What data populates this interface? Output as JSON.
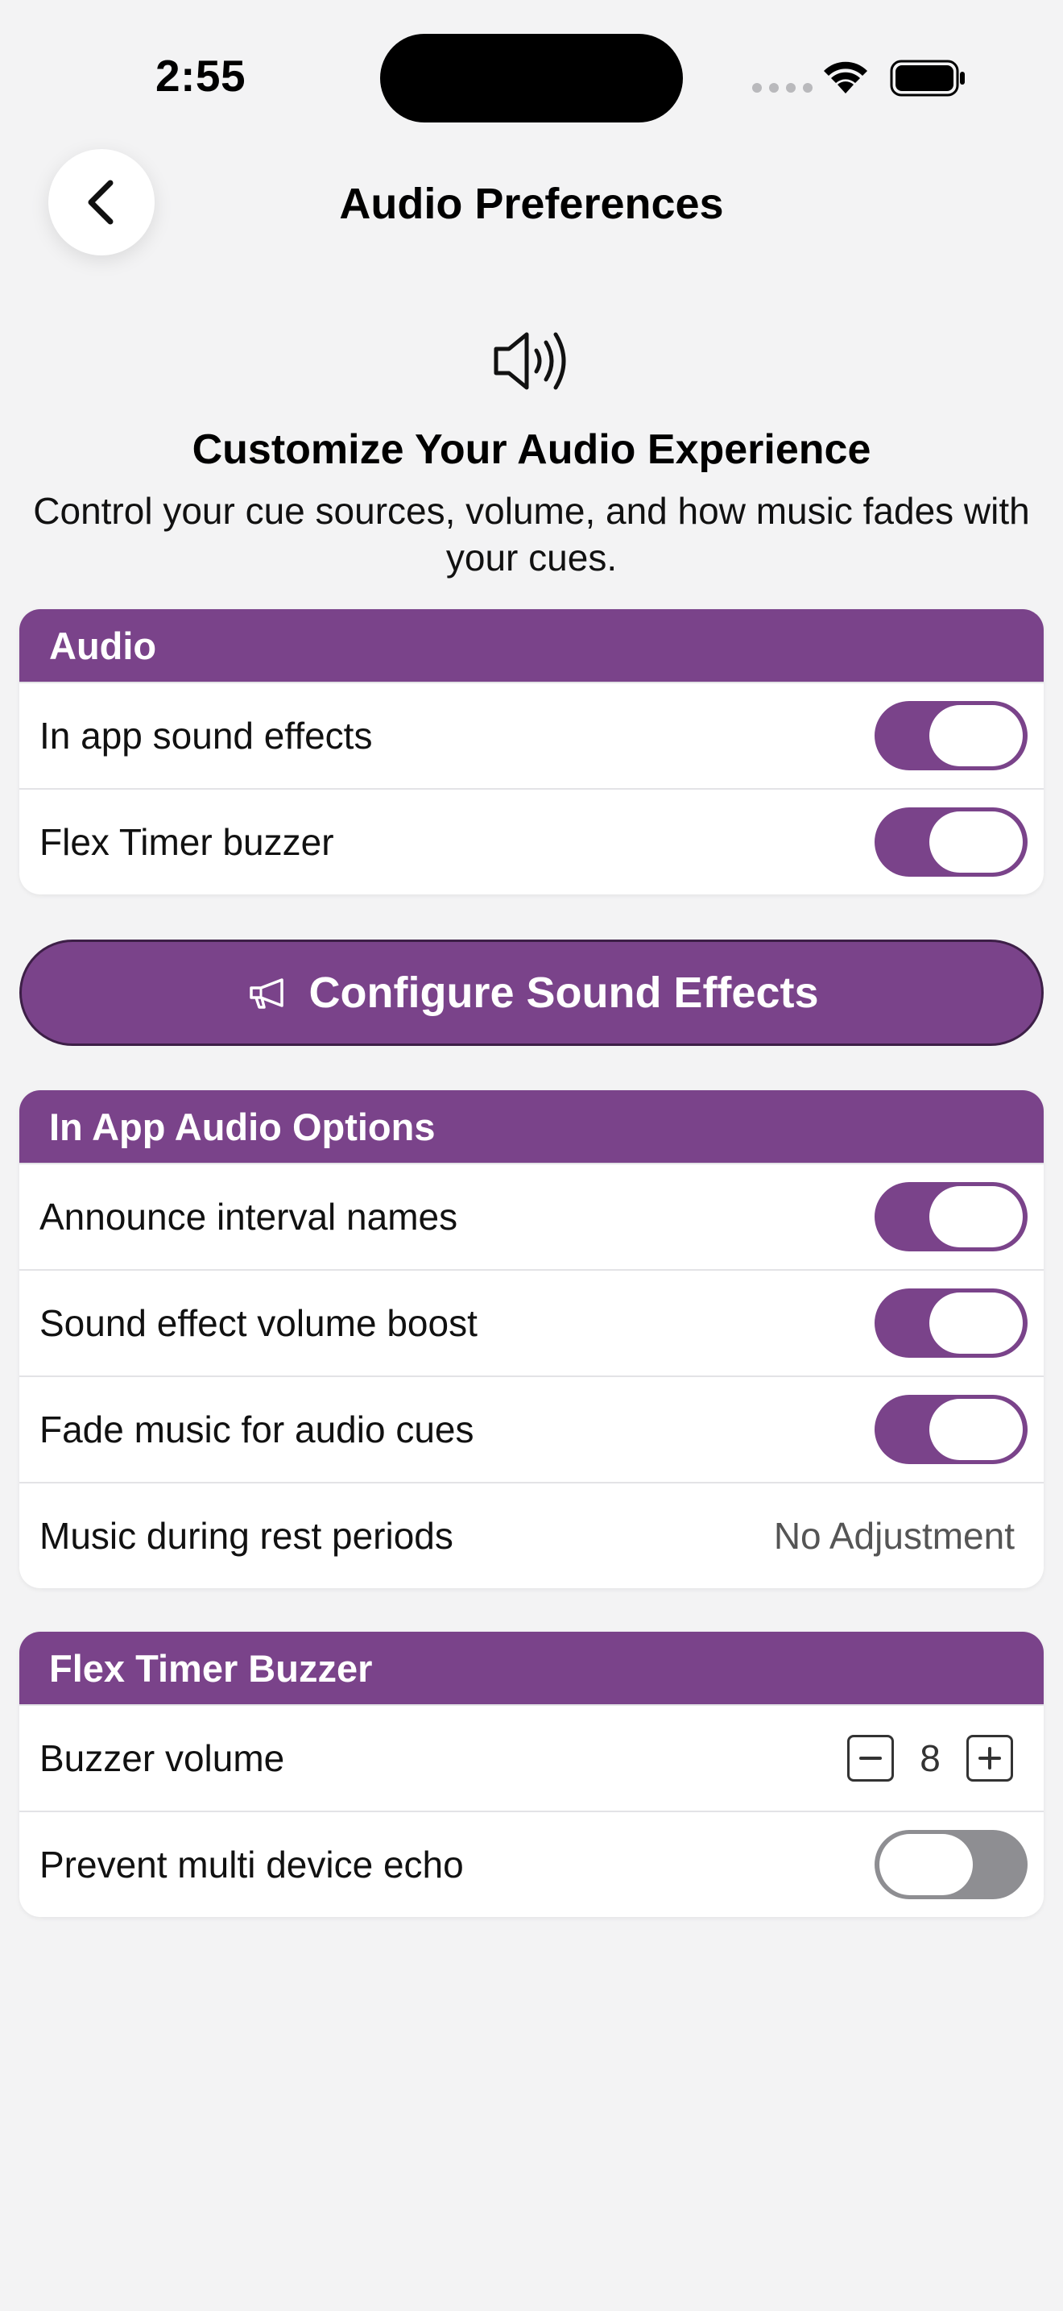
{
  "status": {
    "time": "2:55"
  },
  "nav": {
    "title": "Audio Preferences"
  },
  "hero": {
    "title": "Customize Your Audio Experience",
    "subtitle": "Control your cue sources, volume, and how music fades with your cues."
  },
  "audio_section": {
    "header": "Audio",
    "rows": [
      {
        "label": "In app sound effects",
        "on": true
      },
      {
        "label": "Flex Timer buzzer",
        "on": true
      }
    ]
  },
  "configure_button": {
    "label": "Configure Sound Effects",
    "icon": "megaphone-icon"
  },
  "in_app_section": {
    "header": "In App Audio Options",
    "rows": [
      {
        "label": "Announce interval names",
        "on": true
      },
      {
        "label": "Sound effect volume boost",
        "on": true
      },
      {
        "label": "Fade music for audio cues",
        "on": true
      },
      {
        "label": "Music during rest periods",
        "value": "No Adjustment"
      }
    ]
  },
  "buzzer_section": {
    "header": "Flex Timer Buzzer",
    "volume_label": "Buzzer volume",
    "volume_value": "8",
    "echo_label": "Prevent multi device echo",
    "echo_on": false
  },
  "colors": {
    "accent": "#7a438a",
    "toggle_off": "#8e8e92",
    "background": "#f3f3f4"
  }
}
